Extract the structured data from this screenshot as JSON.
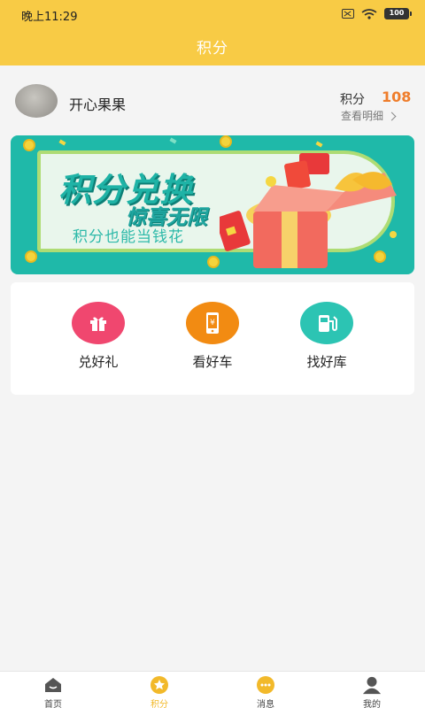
{
  "status_bar": {
    "time": "晚上11:29",
    "battery": "100"
  },
  "header": {
    "title": "积分"
  },
  "profile": {
    "username": "开心果果",
    "points_label": "积分",
    "points_value": "108",
    "detail_link": "查看明细"
  },
  "banner": {
    "title": "积分兑换",
    "subtitle": "惊喜无限",
    "slogan": "积分也能当钱花"
  },
  "actions": [
    {
      "label": "兑好礼",
      "icon": "gift-icon",
      "color": "#f0476f"
    },
    {
      "label": "看好车",
      "icon": "phone-yen-icon",
      "color": "#f28b12"
    },
    {
      "label": "找好库",
      "icon": "fuel-station-icon",
      "color": "#2cc4b3"
    }
  ],
  "tabbar": {
    "items": [
      {
        "label": "首页",
        "icon": "home-icon",
        "active": false
      },
      {
        "label": "积分",
        "icon": "star-icon",
        "active": true
      },
      {
        "label": "消息",
        "icon": "message-icon",
        "active": false
      },
      {
        "label": "我的",
        "icon": "user-icon",
        "active": false
      }
    ]
  },
  "colors": {
    "header": "#f8cb45",
    "accent_points": "#ef7d2b",
    "tab_active": "#f2b92a",
    "banner_bg": "#1fb9a9"
  }
}
